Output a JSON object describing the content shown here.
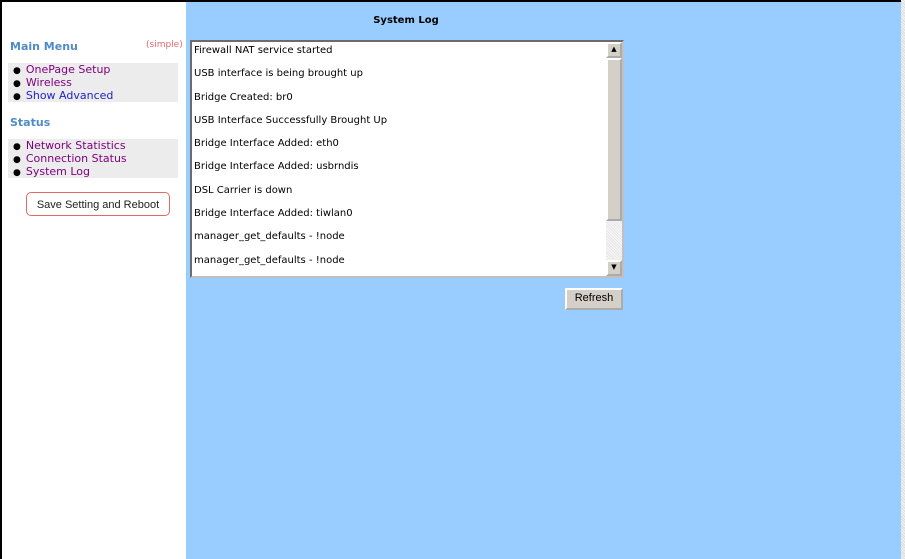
{
  "sidebar": {
    "main_menu": {
      "title": "Main Menu",
      "simple_link": "(simple)",
      "items": [
        {
          "label": "OnePage Setup"
        },
        {
          "label": "Wireless"
        },
        {
          "label": "Show Advanced"
        }
      ]
    },
    "status": {
      "title": "Status",
      "items": [
        {
          "label": "Network Statistics"
        },
        {
          "label": "Connection Status"
        },
        {
          "label": "System Log"
        }
      ]
    },
    "reboot_button": "Save Setting and Reboot"
  },
  "main": {
    "title": "System Log",
    "log_lines": [
      "Firewall NAT service started",
      "USB interface is being brought up",
      "Bridge Created: br0",
      "USB Interface Successfully Brought Up",
      "Bridge Interface Added: eth0",
      "Bridge Interface Added: usbrndis",
      "DSL Carrier is down",
      "Bridge Interface Added: tiwlan0",
      "manager_get_defaults - !node",
      "manager_get_defaults - !node"
    ],
    "refresh_button": "Refresh"
  },
  "colors": {
    "content_background": "#99ccff",
    "menu_heading": "#4f8bc6",
    "visited_link": "#800080",
    "link": "#2222cc",
    "accent_border": "#e06a6a"
  },
  "icons": {
    "scroll_up": "up-arrow-icon",
    "scroll_down": "down-arrow-icon",
    "bullet": "bullet-icon"
  }
}
